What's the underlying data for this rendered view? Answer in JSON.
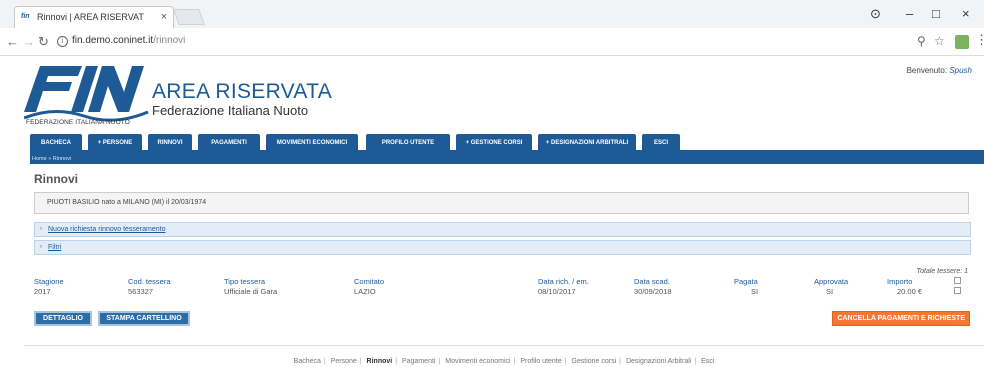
{
  "browser": {
    "tab_title": "Rinnovi | AREA RISERVAT",
    "tab_favicon": "fin",
    "url_host": "fin.demo.coninet.it",
    "url_path": "/rinnovi"
  },
  "header": {
    "logo_text": "FIN",
    "logo_subtitle": "FEDERAZIONE ITALIANA NUOTO",
    "area_title": "AREA RISERVATA",
    "area_subtitle": "Federazione Italiana Nuoto",
    "welcome_label": "Benvenuto:",
    "welcome_user": "Spush"
  },
  "menu": {
    "items": [
      "BACHECA",
      "+ PERSONE",
      "RINNOVI",
      "PAGAMENTI",
      "MOVIMENTI ECONOMICI",
      "PROFILO UTENTE",
      "+ GESTIONE CORSI",
      "+ DESIGNAZIONI ARBITRALI",
      "ESCI"
    ],
    "breadcrumb": "Home » Rinnovi"
  },
  "main": {
    "title": "Rinnovi",
    "person_info": "PIUOTI BASILIO nato a MILANO (MI) il 20/03/1974",
    "accordions": [
      "Nuova richiesta rinnovo tesseramento",
      "Filtri"
    ],
    "total_label": "Totale tessere: 1",
    "table": {
      "headers": [
        "Stagione",
        "Cod. tessera",
        "Tipo tessera",
        "Comitato",
        "Data rich. / em.",
        "Data scad.",
        "Pagata",
        "Approvata",
        "Importo"
      ],
      "rows": [
        [
          "2017",
          "563327",
          "Ufficiale di Gara",
          "LAZIO",
          "08/10/2017",
          "30/09/2018",
          "SI",
          "SI",
          "20.00 €"
        ]
      ]
    },
    "buttons": {
      "detail": "DETTAGLIO",
      "print": "STAMPA CARTELLINO",
      "cancel": "CANCELLA PAGAMENTI E RICHIESTE"
    }
  },
  "footer": {
    "links": [
      "Bacheca",
      "Persone",
      "Rinnovi",
      "Pagamenti",
      "Movimenti economici",
      "Profilo utente",
      "Gestione corsi",
      "Designazioni Arbitrali",
      "Esci"
    ],
    "current": "Rinnovi"
  },
  "colors": {
    "brand": "#1d5a96",
    "danger": "#f07a33"
  }
}
